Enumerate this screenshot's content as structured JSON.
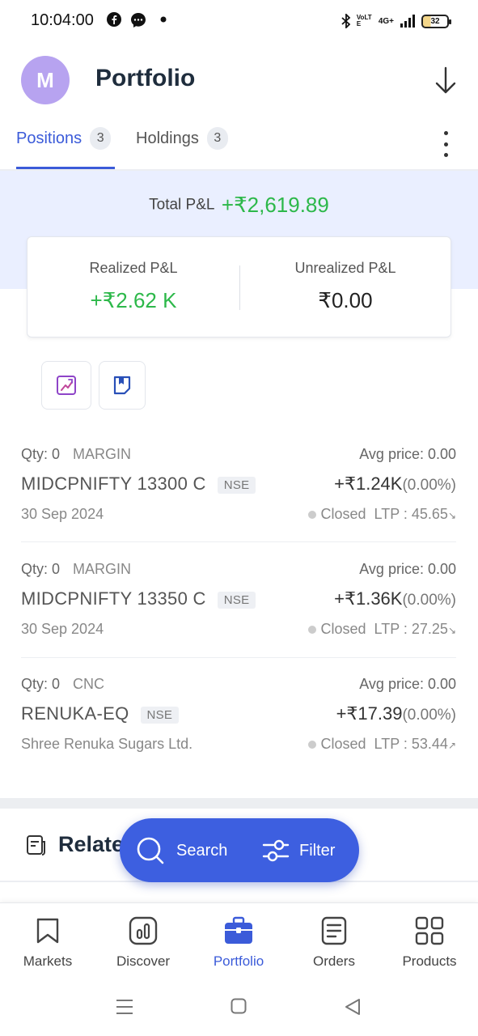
{
  "status_bar": {
    "time": "10:04:00",
    "network_label": "VoLTE",
    "signal_label": "4G+",
    "battery": "32"
  },
  "header": {
    "avatar_initial": "M",
    "title": "Portfolio"
  },
  "tabs": [
    {
      "label": "Positions",
      "count": "3",
      "active": true
    },
    {
      "label": "Holdings",
      "count": "3",
      "active": false
    }
  ],
  "summary": {
    "total_label": "Total P&L",
    "total_value": "+₹2,619.89",
    "realized_label": "Realized P&L",
    "realized_value": "+₹2.62 K",
    "unrealized_label": "Unrealized P&L",
    "unrealized_value": "₹0.00"
  },
  "positions": [
    {
      "qty": "Qty: 0",
      "product": "MARGIN",
      "avg_price": "Avg price: 0.00",
      "symbol": "MIDCPNIFTY 13300 C",
      "exchange": "NSE",
      "pnl": "+₹1.24K",
      "pnl_pct": "(0.00%)",
      "sub": "30 Sep 2024",
      "status": "Closed",
      "ltp": "LTP : 45.65",
      "trend": "↘"
    },
    {
      "qty": "Qty: 0",
      "product": "MARGIN",
      "avg_price": "Avg price: 0.00",
      "symbol": "MIDCPNIFTY 13350 C",
      "exchange": "NSE",
      "pnl": "+₹1.36K",
      "pnl_pct": "(0.00%)",
      "sub": "30 Sep 2024",
      "status": "Closed",
      "ltp": "LTP : 27.25",
      "trend": "↘"
    },
    {
      "qty": "Qty: 0",
      "product": "CNC",
      "avg_price": "Avg price: 0.00",
      "symbol": "RENUKA-EQ",
      "exchange": "NSE",
      "pnl": "+₹17.39",
      "pnl_pct": "(0.00%)",
      "sub": "Shree Renuka Sugars Ltd.",
      "status": "Closed",
      "ltp": "LTP : 53.44",
      "trend": "↗"
    }
  ],
  "related": {
    "title": "Relate"
  },
  "fab": {
    "search_label": "Search",
    "filter_label": "Filter"
  },
  "bottom_nav": [
    {
      "label": "Markets",
      "icon": "bookmark-icon"
    },
    {
      "label": "Discover",
      "icon": "discover-chart-icon"
    },
    {
      "label": "Portfolio",
      "icon": "briefcase-icon",
      "active": true
    },
    {
      "label": "Orders",
      "icon": "orders-list-icon"
    },
    {
      "label": "Products",
      "icon": "grid-icon"
    }
  ],
  "colors": {
    "accent": "#3b5bd9",
    "profit": "#2db84a",
    "band": "#eaefff",
    "fab": "#3d5fe0"
  }
}
